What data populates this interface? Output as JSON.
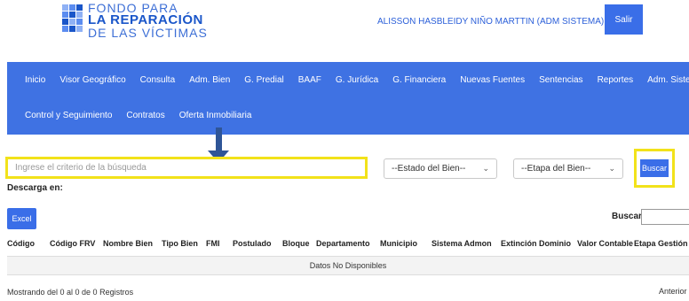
{
  "logo": {
    "line1": "FONDO PARA",
    "line2": "LA REPARACIÓN",
    "line3": "DE LAS VÍCTIMAS",
    "colors": [
      "#5b8cf0",
      "#1a56c9",
      "#8fb1f5"
    ]
  },
  "header": {
    "user": "ALISSON HASBLEIDY NIÑO MARTTIN (ADM SISTEMA)",
    "user_caret": "▾",
    "logout": "Salir"
  },
  "nav": {
    "row1": [
      "Inicio",
      "Visor Geográfico",
      "Consulta",
      "Adm. Bien",
      "G. Predial",
      "BAAF",
      "G. Jurídica",
      "G. Financiera",
      "Nuevas Fuentes",
      "Sentencias",
      "Reportes",
      "Adm. Sistema"
    ],
    "row2": [
      "Control y Seguimiento",
      "Contratos",
      "Oferta Inmobiliaria"
    ]
  },
  "search": {
    "placeholder": "Ingrese el criterio de la búsqueda",
    "estado": "--Estado del Bien--",
    "etapa": "--Etapa del Bien--",
    "buscar": "Buscar"
  },
  "download": {
    "label": "Descarga en:",
    "excel": "Excel"
  },
  "table": {
    "search_label": "Buscar:",
    "columns": [
      "Código",
      "Código FRV",
      "Nombre Bien",
      "Tipo Bien",
      "FMI",
      "Postulado",
      "Bloque",
      "Departamento",
      "Municipio",
      "Sistema Admon",
      "Extinción Dominio",
      "Valor Contable",
      "Etapa Gestión"
    ],
    "empty": "Datos No Disponibles"
  },
  "footer": {
    "info": "Mostrando del 0 al 0 de 0 Registros",
    "prev": "Anterior"
  },
  "colors": {
    "nav": "#3f72e3",
    "button": "#3a6ee8",
    "highlight": "#f2e21a",
    "arrow": "#2f5597"
  }
}
